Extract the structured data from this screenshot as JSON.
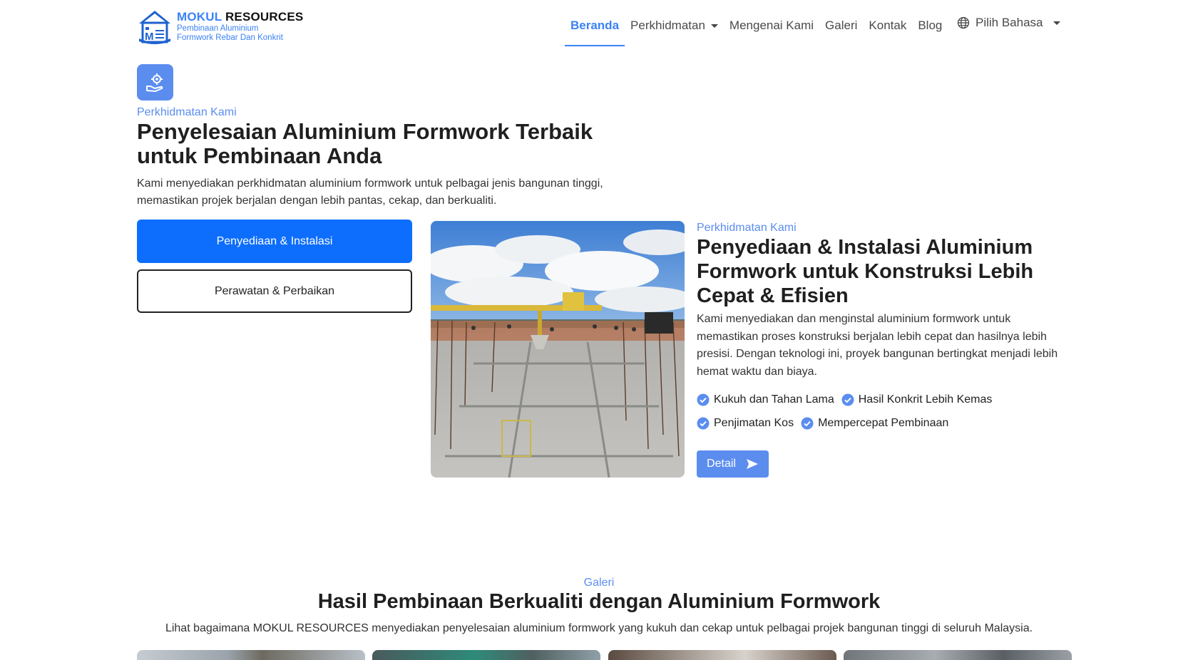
{
  "brand": {
    "name_highlight": "MOKUL",
    "name_rest": " RESOURCES",
    "tagline_line1": "Pembinaan Aluminium",
    "tagline_line2": "Formwork Rebar Dan Konkrit",
    "logo_icon": "house-logo-icon"
  },
  "nav": {
    "items": [
      {
        "label": "Beranda",
        "active": true
      },
      {
        "label": "Perkhidmatan",
        "has_dropdown": true
      },
      {
        "label": "Mengenai Kami"
      },
      {
        "label": "Galeri"
      },
      {
        "label": "Kontak"
      },
      {
        "label": "Blog"
      }
    ],
    "language": {
      "label": "Pilih Bahasa",
      "icon": "globe-icon"
    }
  },
  "hero": {
    "icon": "service-hand-gear-icon",
    "eyebrow": "Perkhidmatan Kami",
    "title": "Penyelesaian Aluminium Formwork Terbaik untuk Pembinaan Anda",
    "description": "Kami menyediakan perkhidmatan aluminium formwork untuk pelbagai jenis bangunan tinggi, memastikan projek berjalan dengan lebih pantas, cekap, dan berkualiti.",
    "tabs": [
      {
        "label": "Penyediaan & Instalasi",
        "selected": true
      },
      {
        "label": "Perawatan & Perbaikan",
        "selected": false
      }
    ]
  },
  "detail": {
    "eyebrow": "Perkhidmatan Kami",
    "title": "Penyediaan & Instalasi Aluminium Formwork untuk Konstruksi Lebih Cepat & Efisien",
    "description": "Kami menyediakan dan menginstal aluminium formwork untuk memastikan proses konstruksi berjalan lebih cepat dan hasilnya lebih presisi. Dengan teknologi ini, proyek bangunan bertingkat menjadi lebih hemat waktu dan biaya.",
    "features": [
      "Kukuh dan Tahan Lama",
      "Hasil Konkrit Lebih Kemas",
      "Penjimatan Kos",
      "Mempercepat Pembinaan"
    ],
    "button_label": "Detail"
  },
  "gallery": {
    "eyebrow": "Galeri",
    "title": "Hasil Pembinaan Berkualiti dengan Aluminium Formwork",
    "description": "Lihat bagaimana MOKUL RESOURCES menyediakan penyelesaian aluminium formwork yang kukuh dan cekap untuk pelbagai projek bangunan tinggi di seluruh Malaysia."
  },
  "colors": {
    "accent": "#5b8def",
    "primary_button": "#0d6efd",
    "text_dark": "#1f1f1f"
  }
}
